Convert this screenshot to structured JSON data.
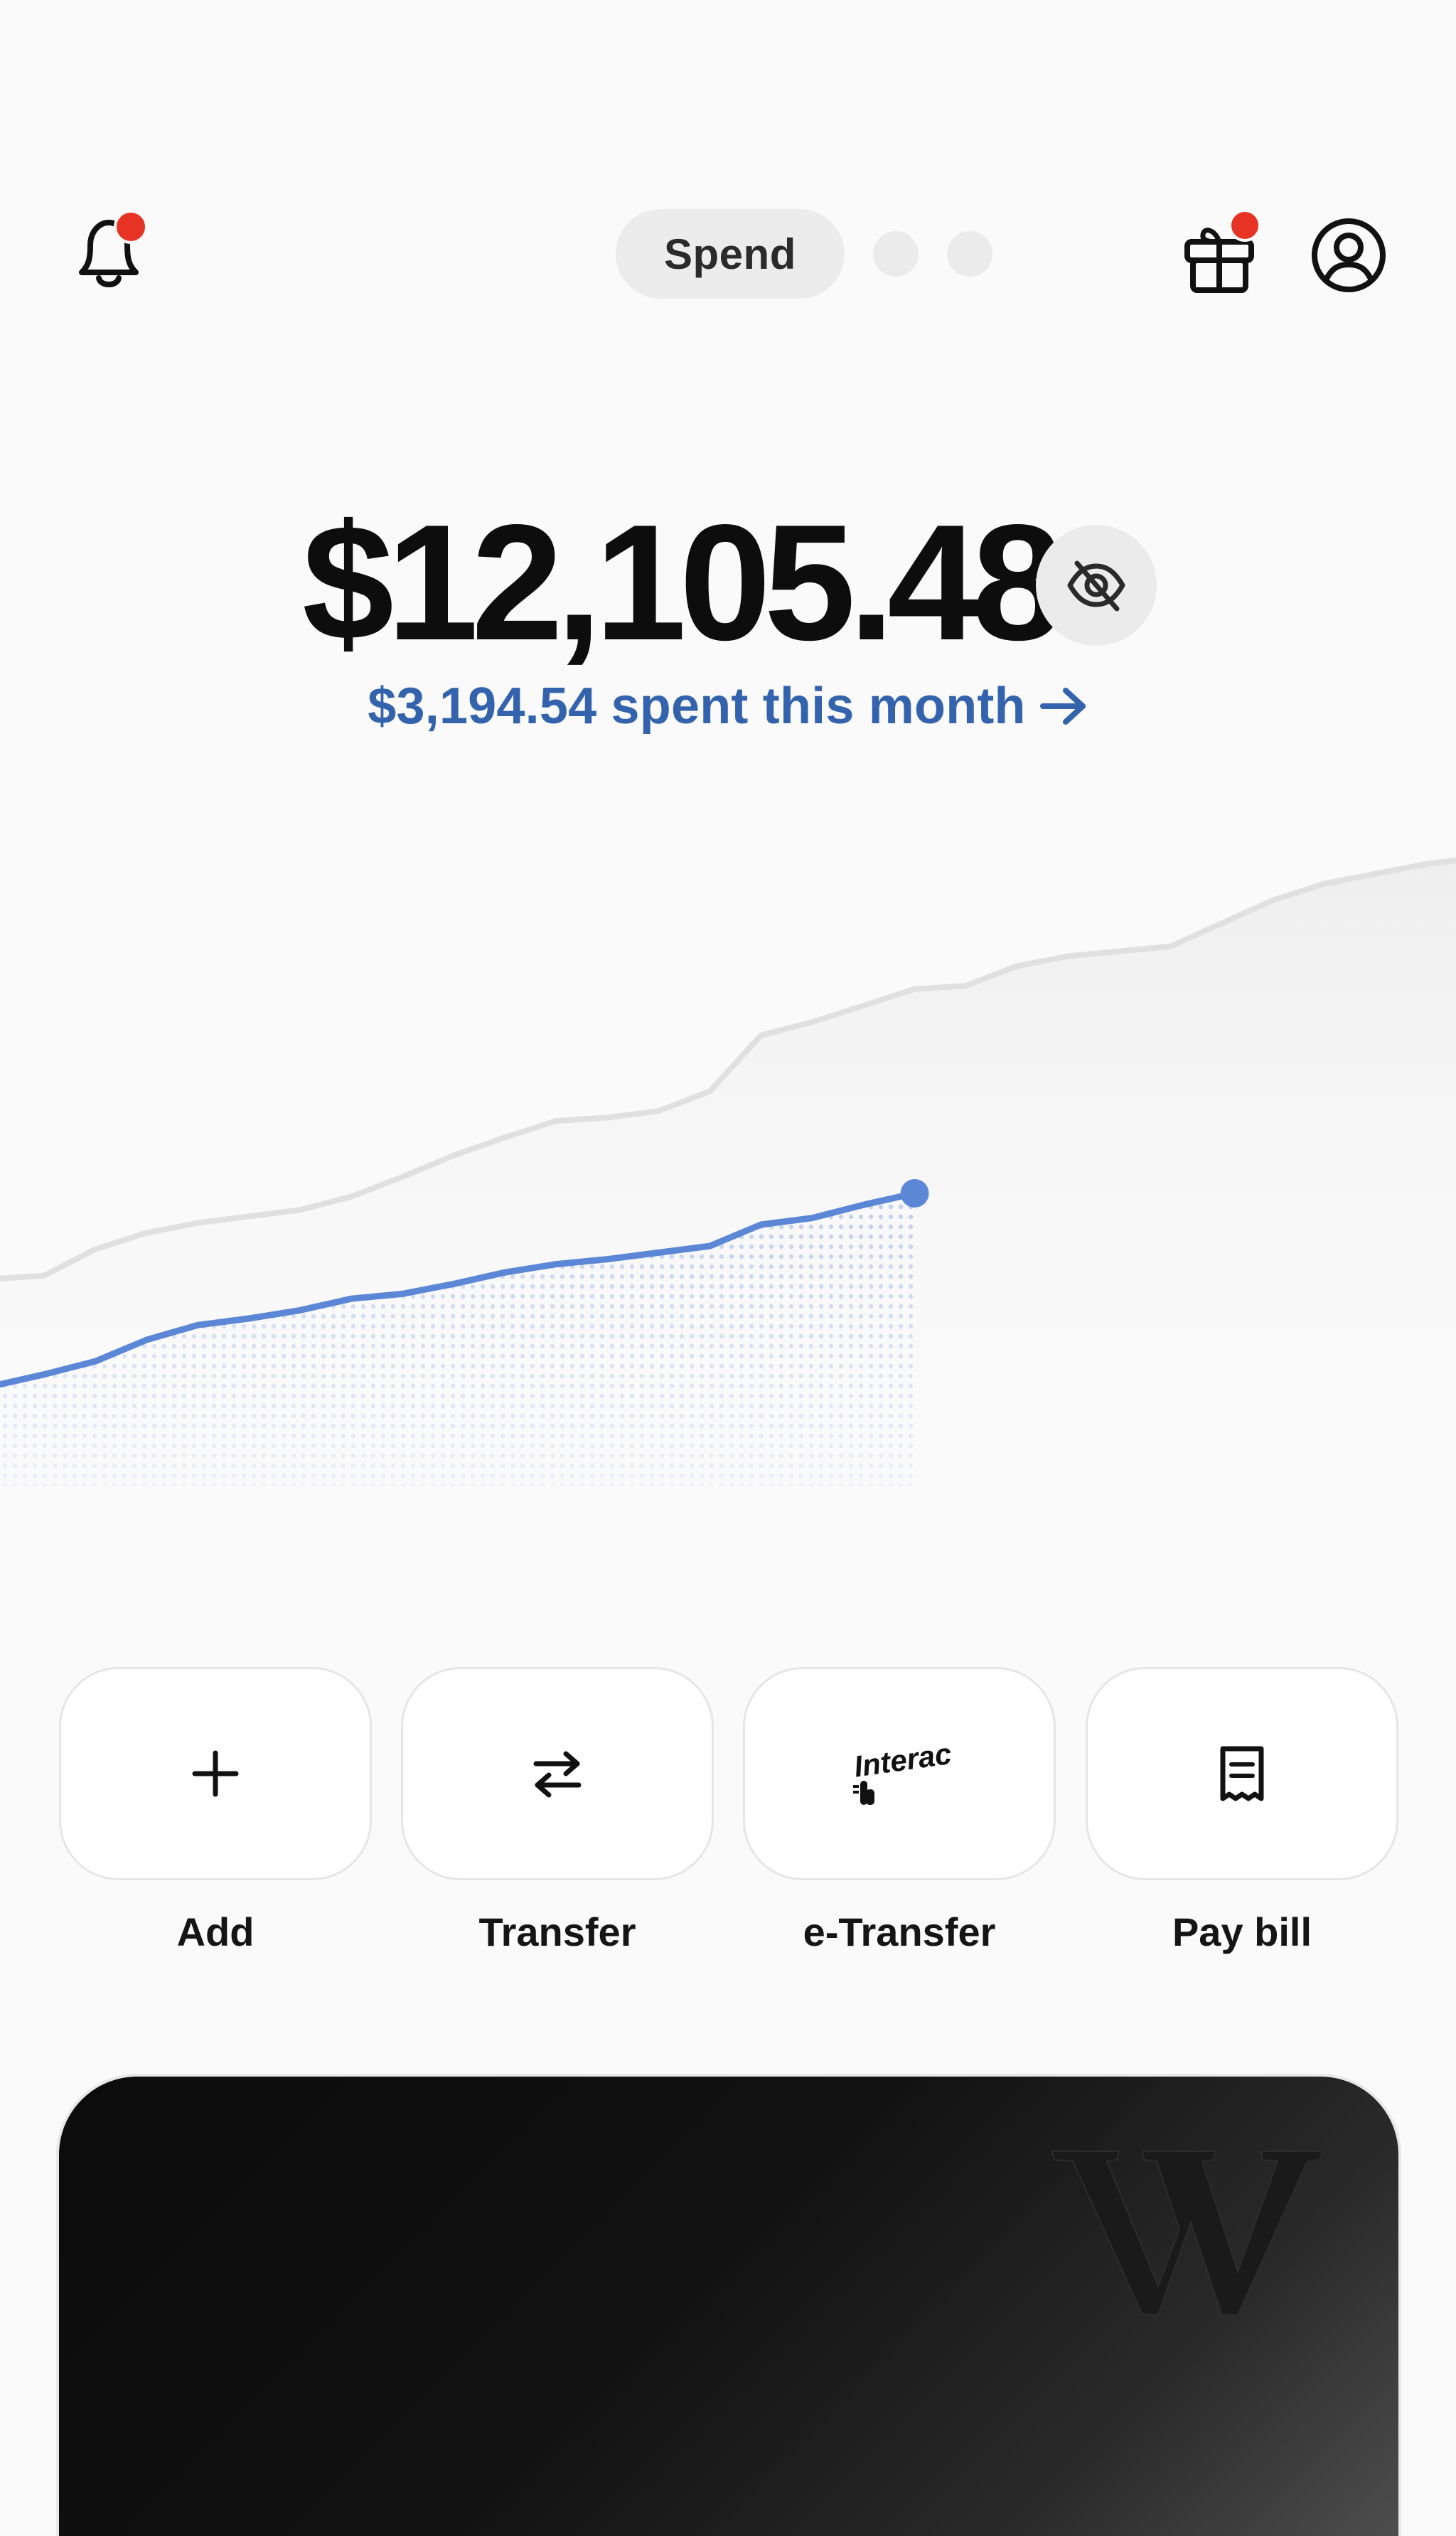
{
  "header": {
    "notifications_icon": "bell-icon",
    "notification_badge_color": "#e63323",
    "active_page_label": "Spend",
    "page_count": 3,
    "rewards_icon": "gift-icon",
    "profile_icon": "user-circle-icon"
  },
  "balance": {
    "amount": "$12,105.48",
    "visibility_icon": "eye-off-icon",
    "spent_text": "$3,194.54 spent this month",
    "spent_color": "#3463ad"
  },
  "chart_data": {
    "type": "area",
    "series": [
      {
        "role": "previous-month",
        "color": "#e0e0e0",
        "values": [
          100,
          102,
          118,
          128,
          134,
          138,
          142,
          150,
          162,
          175,
          186,
          196,
          198,
          202,
          214,
          248,
          256,
          266,
          276,
          278,
          290,
          296,
          299,
          302,
          316,
          330,
          340,
          346,
          352,
          356
        ]
      },
      {
        "role": "current-month",
        "color": "#5b87d6",
        "values": [
          35,
          42,
          50,
          63,
          72,
          76,
          81,
          88,
          91,
          97,
          104,
          109,
          112,
          116,
          120,
          133,
          137,
          145,
          152
        ]
      }
    ],
    "grid": false
  },
  "actions": [
    {
      "label": "Add",
      "icon": "plus-icon"
    },
    {
      "label": "Transfer",
      "icon": "transfer-arrows-icon"
    },
    {
      "label": "e-Transfer",
      "icon": "interac-icon",
      "icon_text": "Interac"
    },
    {
      "label": "Pay bill",
      "icon": "receipt-icon"
    }
  ],
  "card": {
    "logo_icon": "w-logo-icon",
    "background": "#0d0d0d"
  }
}
